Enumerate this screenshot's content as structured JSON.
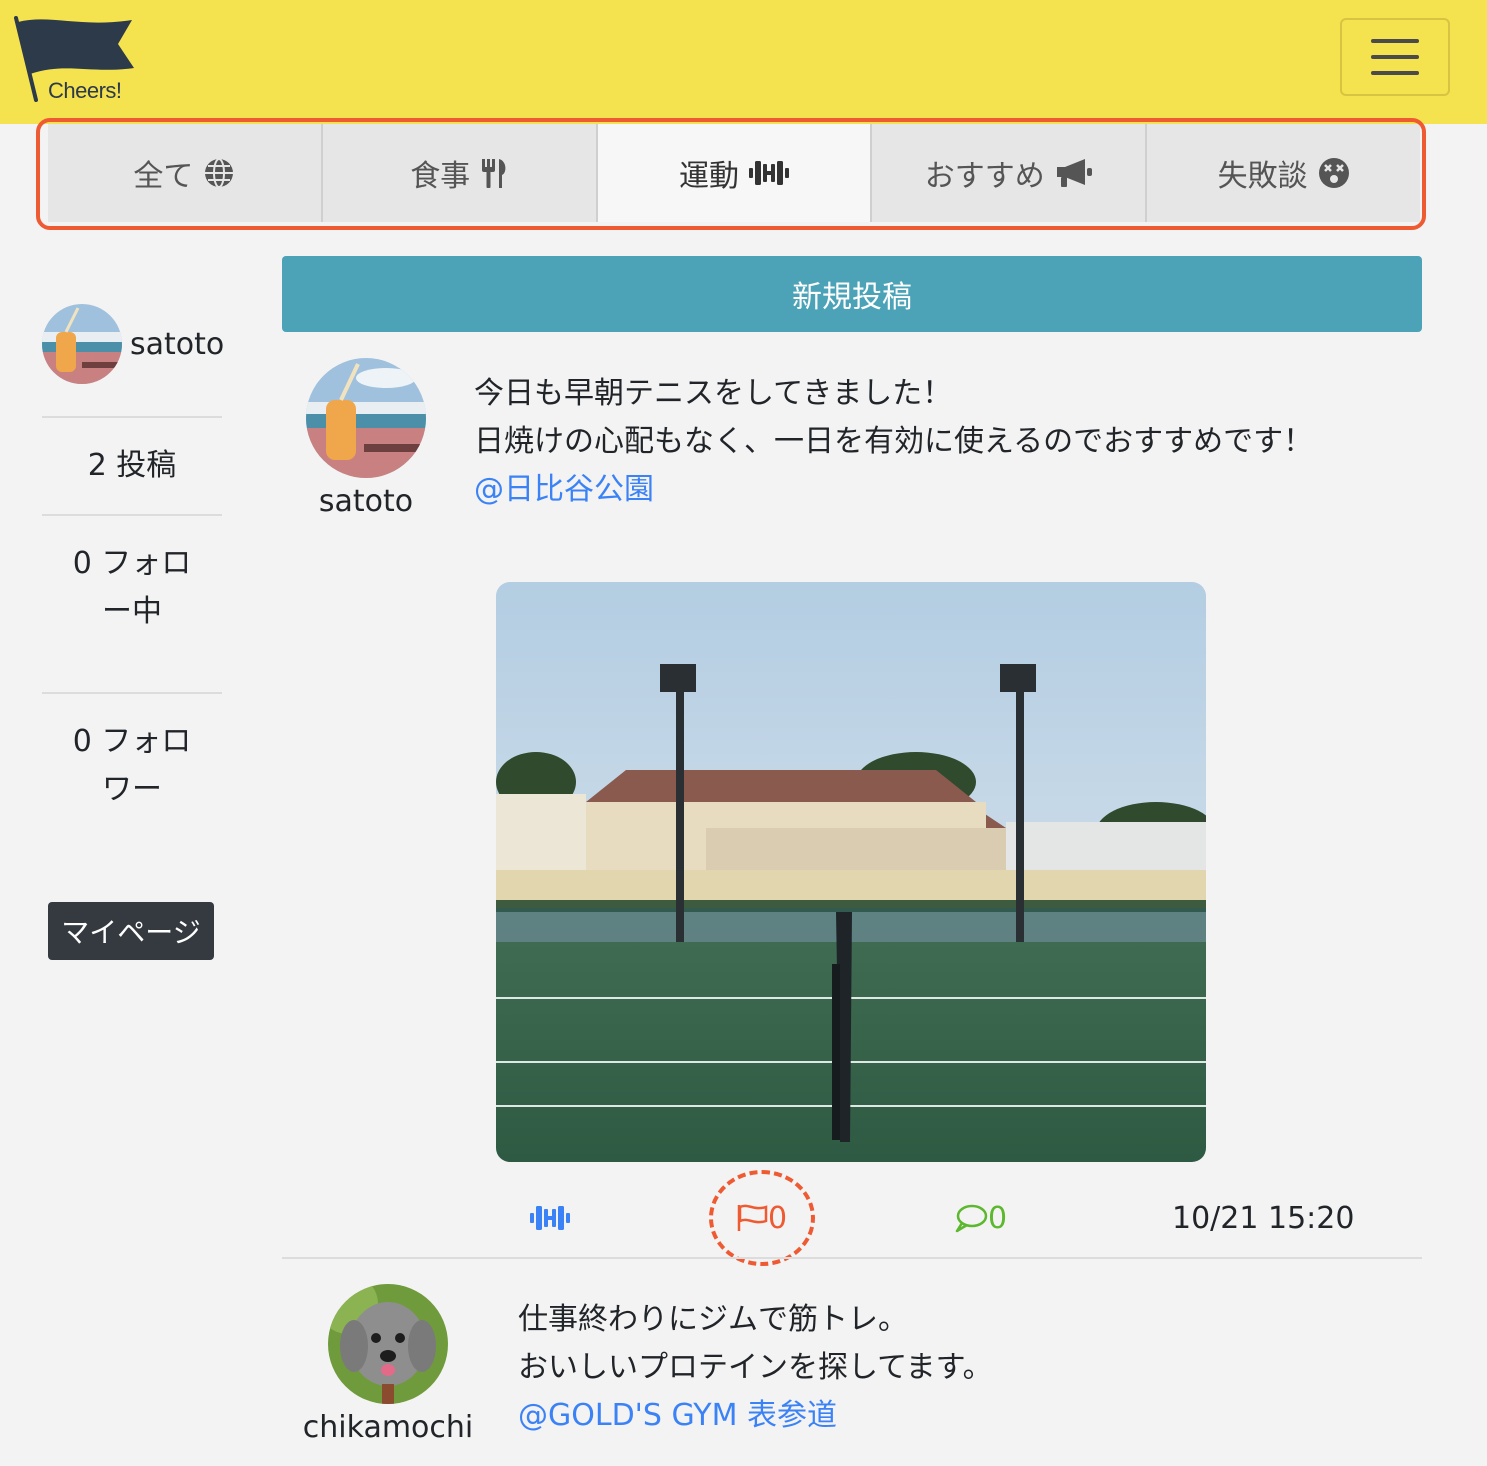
{
  "app": {
    "logo_text": "Cheers!"
  },
  "tabs": [
    {
      "label": "全て",
      "icon": "globe-icon",
      "active": false
    },
    {
      "label": "食事",
      "icon": "utensils-icon",
      "active": false
    },
    {
      "label": "運動",
      "icon": "dumbbell-icon",
      "active": true
    },
    {
      "label": "おすすめ",
      "icon": "megaphone-icon",
      "active": false
    },
    {
      "label": "失敗談",
      "icon": "dizzy-face-icon",
      "active": false
    }
  ],
  "sidebar": {
    "username": "satoto",
    "posts": "2 投稿",
    "following_line1": "0 フォロ",
    "following_line2": "ー中",
    "followers_line1": "0 フォロ",
    "followers_line2": "ワー",
    "mypage_label": "マイページ"
  },
  "new_post_label": "新規投稿",
  "posts": [
    {
      "username": "satoto",
      "text_line1": "今日も早朝テニスをしてきました！",
      "text_line2": "日焼けの心配もなく、一日を有効に使えるのでおすすめです！",
      "location": "@日比谷公園",
      "cheers_count": "0",
      "comment_count": "0",
      "timestamp": "10/21 15:20"
    },
    {
      "username": "chikamochi",
      "text_line1": "仕事終わりにジムで筋トレ。",
      "text_line2": "おいしいプロテインを探してます。",
      "location": "@GOLD'S GYM 表参道"
    }
  ],
  "colors": {
    "header": "#f4e24e",
    "accent_blue": "#3b82f6",
    "cheers_orange": "#ee5a32",
    "comment_green": "#5cb82e",
    "new_post_bg": "#4ca3b8"
  }
}
